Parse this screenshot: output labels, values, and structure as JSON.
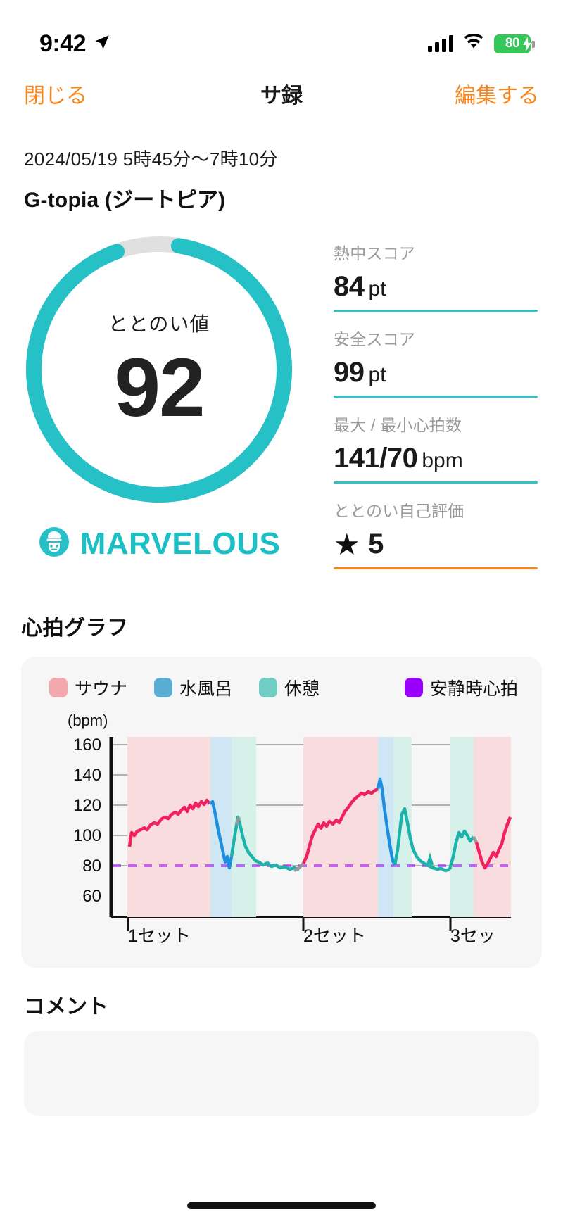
{
  "statusbar": {
    "time": "9:42",
    "location_icon": "location-arrow-icon",
    "signal_icon": "cellular-signal-icon",
    "wifi_icon": "wifi-icon",
    "battery_percent": "80",
    "battery_charging": true
  },
  "navbar": {
    "close_label": "閉じる",
    "title": "サ録",
    "edit_label": "編集する"
  },
  "header": {
    "date_range": "2024/05/19 5時45分〜7時10分",
    "venue": "G-topia (ジートピア)"
  },
  "gauge": {
    "label": "ととのい値",
    "value": "92",
    "percent": 92,
    "rank_label": "MARVELOUS",
    "rank_icon": "sauna-hat-badge-icon",
    "arc_color": "#25c1c7",
    "track_color": "#e0e0e0"
  },
  "stats": [
    {
      "label": "熱中スコア",
      "value": "84",
      "unit": "pt",
      "rule_color": "#2bc4c9"
    },
    {
      "label": "安全スコア",
      "value": "99",
      "unit": "pt",
      "rule_color": "#2bc4c9"
    },
    {
      "label": "最大 / 最小心拍数",
      "value": "141/70",
      "unit": "bpm",
      "rule_color": "#2bc4c9"
    },
    {
      "label": "ととのい自己評価",
      "value": "5",
      "unit": "",
      "star": "★",
      "rule_color": "#f5861f"
    }
  ],
  "chart_section": {
    "title": "心拍グラフ"
  },
  "chart_data": {
    "type": "line",
    "title": "心拍グラフ",
    "ylabel": "(bpm)",
    "xlabel": "",
    "ylim": [
      50,
      170
    ],
    "yticks": [
      160,
      140,
      120,
      100,
      80,
      60
    ],
    "gridlines": [
      160,
      120,
      80
    ],
    "grid": true,
    "legend_position": "top",
    "legend": [
      {
        "name": "サウナ",
        "color": "#f2a8ad"
      },
      {
        "name": "水風呂",
        "color": "#5aaed4"
      },
      {
        "name": "休憩",
        "color": "#6fcdc4"
      },
      {
        "name": "安静時心拍",
        "color": "#9900ff"
      }
    ],
    "xticks": [
      "1セット",
      "2セット",
      "3セッ"
    ],
    "resting_hr": 80,
    "series": [
      {
        "name": "サウナ",
        "line_color": "#f0215e",
        "fill_color": "rgba(242,168,173,0.38)",
        "band_color": "#f9d6d8",
        "values": [
          97,
          104,
          105,
          106,
          108,
          110,
          111,
          113,
          114,
          116,
          117,
          118,
          120,
          122,
          121,
          123,
          126,
          124,
          128,
          130,
          127,
          129,
          126,
          125,
          124,
          123
        ]
      },
      {
        "name": "水風呂",
        "line_color": "#1d8ee0",
        "band_color": "#cfe6f2",
        "values": [
          124,
          118,
          106,
          96,
          88,
          84,
          90,
          100,
          108,
          113
        ]
      },
      {
        "name": "休憩",
        "line_color": "#1cb3ab",
        "band_color": "#d4efe9",
        "values": [
          113,
          105,
          98,
          93,
          90,
          88,
          86,
          85,
          84,
          83,
          82,
          81,
          80,
          79,
          79,
          78,
          78,
          77
        ]
      }
    ],
    "sets": [
      {
        "label": "1セット",
        "sauna_peak": 131,
        "cold_min": 84,
        "rest_peak": 114
      },
      {
        "label": "2セット",
        "sauna_peak": 138,
        "cold_min": 83,
        "rest_peak": 119
      },
      {
        "label": "3セッ",
        "sauna_peak": 112,
        "cold_min": 79,
        "rest_peak": 105
      }
    ]
  },
  "comment_section": {
    "title": "コメント"
  }
}
